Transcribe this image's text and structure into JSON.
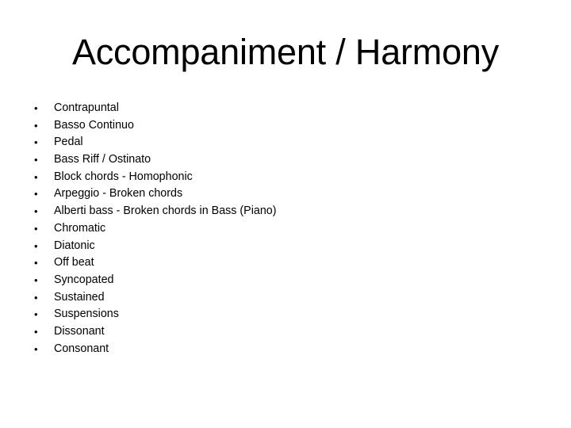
{
  "slide": {
    "title": "Accompaniment / Harmony",
    "background_color": "#ffffff",
    "text_color": "#000000",
    "bullet_glyph": "•",
    "bullets": [
      {
        "label": "Contrapuntal"
      },
      {
        "label": "Basso Continuo"
      },
      {
        "label": "Pedal"
      },
      {
        "label": "Bass Riff / Ostinato"
      },
      {
        "label": "Block chords - Homophonic"
      },
      {
        "label": "Arpeggio - Broken chords"
      },
      {
        "label": "Alberti bass - Broken chords in Bass (Piano)"
      },
      {
        "label": "Chromatic"
      },
      {
        "label": "Diatonic"
      },
      {
        "label": "Off beat"
      },
      {
        "label": "Syncopated"
      },
      {
        "label": "Sustained"
      },
      {
        "label": "Suspensions"
      },
      {
        "label": "Dissonant"
      },
      {
        "label": "Consonant"
      }
    ]
  }
}
